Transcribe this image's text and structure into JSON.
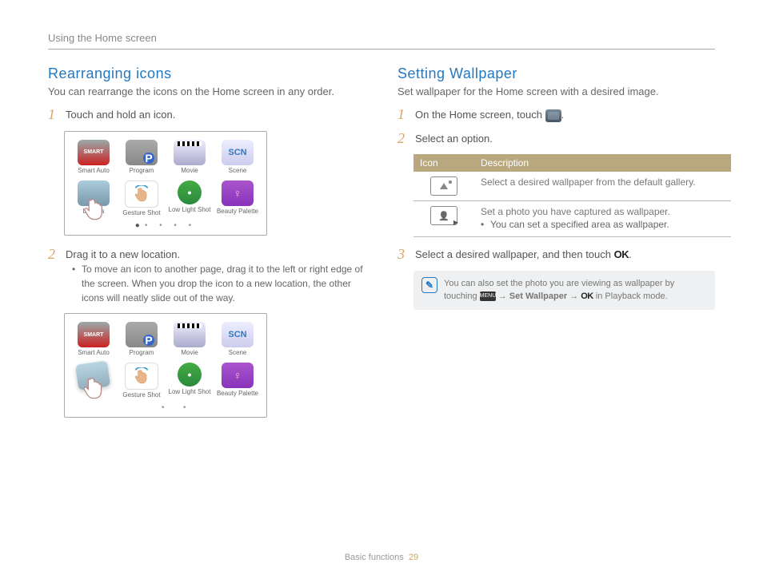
{
  "header": "Using the Home screen",
  "footer_section": "Basic functions",
  "footer_page": "29",
  "left": {
    "title": "Rearranging icons",
    "intro": "You can rearrange the icons on the Home screen in any order.",
    "step1": "Touch and hold an icon.",
    "step2": "Drag it to a new location.",
    "step2_bullet": "To move an icon to another page, drag it to the left or right edge of the screen. When you drop the icon to a new location, the other icons will neatly slide out of the way.",
    "icons": {
      "smart": "Smart Auto",
      "program": "Program",
      "movie": "Movie",
      "scene": "Scene",
      "livep": "Live Pa",
      "gesture": "Gesture Shot",
      "lowlight": "Low Light Shot",
      "beauty": "Beauty Palette"
    }
  },
  "right": {
    "title": "Setting Wallpaper",
    "intro": "Set wallpaper for the Home screen with a desired image.",
    "step1_a": "On the Home screen, touch ",
    "step1_b": ".",
    "step2": "Select an option.",
    "table": {
      "h1": "Icon",
      "h2": "Description",
      "r1": "Select a desired wallpaper from the default gallery.",
      "r2a": "Set a photo you have captured as wallpaper.",
      "r2b": "You can set a specified area as wallpaper."
    },
    "step3_a": "Select a desired wallpaper, and then touch ",
    "step3_ok": "OK",
    "step3_b": ".",
    "note_a": "You can also set the photo you are viewing as wallpaper by touching ",
    "note_arrow": " → ",
    "note_bold": "Set Wallpaper",
    "note_ok": "OK",
    "note_b": " in Playback mode."
  }
}
